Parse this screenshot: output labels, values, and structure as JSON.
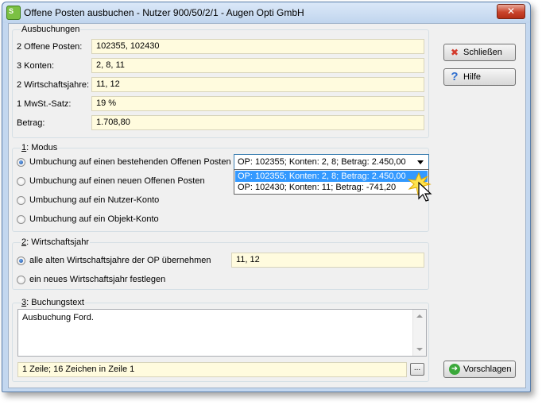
{
  "window": {
    "title": "Offene Posten ausbuchen - Nutzer 900/50/2/1 - Augen Opti GmbH",
    "app_icon_text": "S",
    "close_glyph": "✕"
  },
  "ausbuchungen": {
    "title": "Ausbuchungen",
    "rows": [
      {
        "label": "2 Offene Posten:",
        "value": "102355,  102430"
      },
      {
        "label": "3 Konten:",
        "value": "2,  8,  11"
      },
      {
        "label": "2 Wirtschaftsjahre:",
        "value": "11,  12"
      },
      {
        "label": "1 MwSt.-Satz:",
        "value": "19 %"
      },
      {
        "label": "Betrag:",
        "value": "1.708,80"
      }
    ]
  },
  "modus": {
    "title_key": "1",
    "title_rest": ": Modus",
    "options": [
      {
        "label": "Umbuchung auf einen bestehenden Offenen Posten",
        "selected": true
      },
      {
        "label": "Umbuchung auf einen neuen Offenen Posten",
        "selected": false
      },
      {
        "label": "Umbuchung auf ein Nutzer-Konto",
        "selected": false
      },
      {
        "label": "Umbuchung auf ein Objekt-Konto",
        "selected": false
      }
    ],
    "combo_value": "OP: 102355;  Konten: 2, 8;  Betrag: 2.450,00",
    "dropdown_options": [
      "OP: 102355;  Konten: 2, 8;  Betrag: 2.450,00",
      "OP: 102430;  Konten: 11;  Betrag: -741,20"
    ]
  },
  "wirtschaftsjahr": {
    "title_key": "2",
    "title_rest": ": Wirtschaftsjahr",
    "options": [
      {
        "label": "alle alten Wirtschaftsjahre der OP übernehmen",
        "selected": true
      },
      {
        "label": "ein neues Wirtschaftsjahr festlegen",
        "selected": false
      }
    ],
    "value": "11,  12"
  },
  "buchungstext": {
    "title_key": "3",
    "title_rest": ": Buchungstext",
    "text": "Ausbuchung Ford.",
    "status": "1 Zeile; 16 Zeichen in Zeile 1",
    "browse_label": "..."
  },
  "buttons": {
    "close_label": "Schließen",
    "help_label": "Hilfe",
    "suggest_label": "Vorschlagen"
  },
  "colors": {
    "field_bg": "#fffbde",
    "selection": "#3399ff"
  }
}
